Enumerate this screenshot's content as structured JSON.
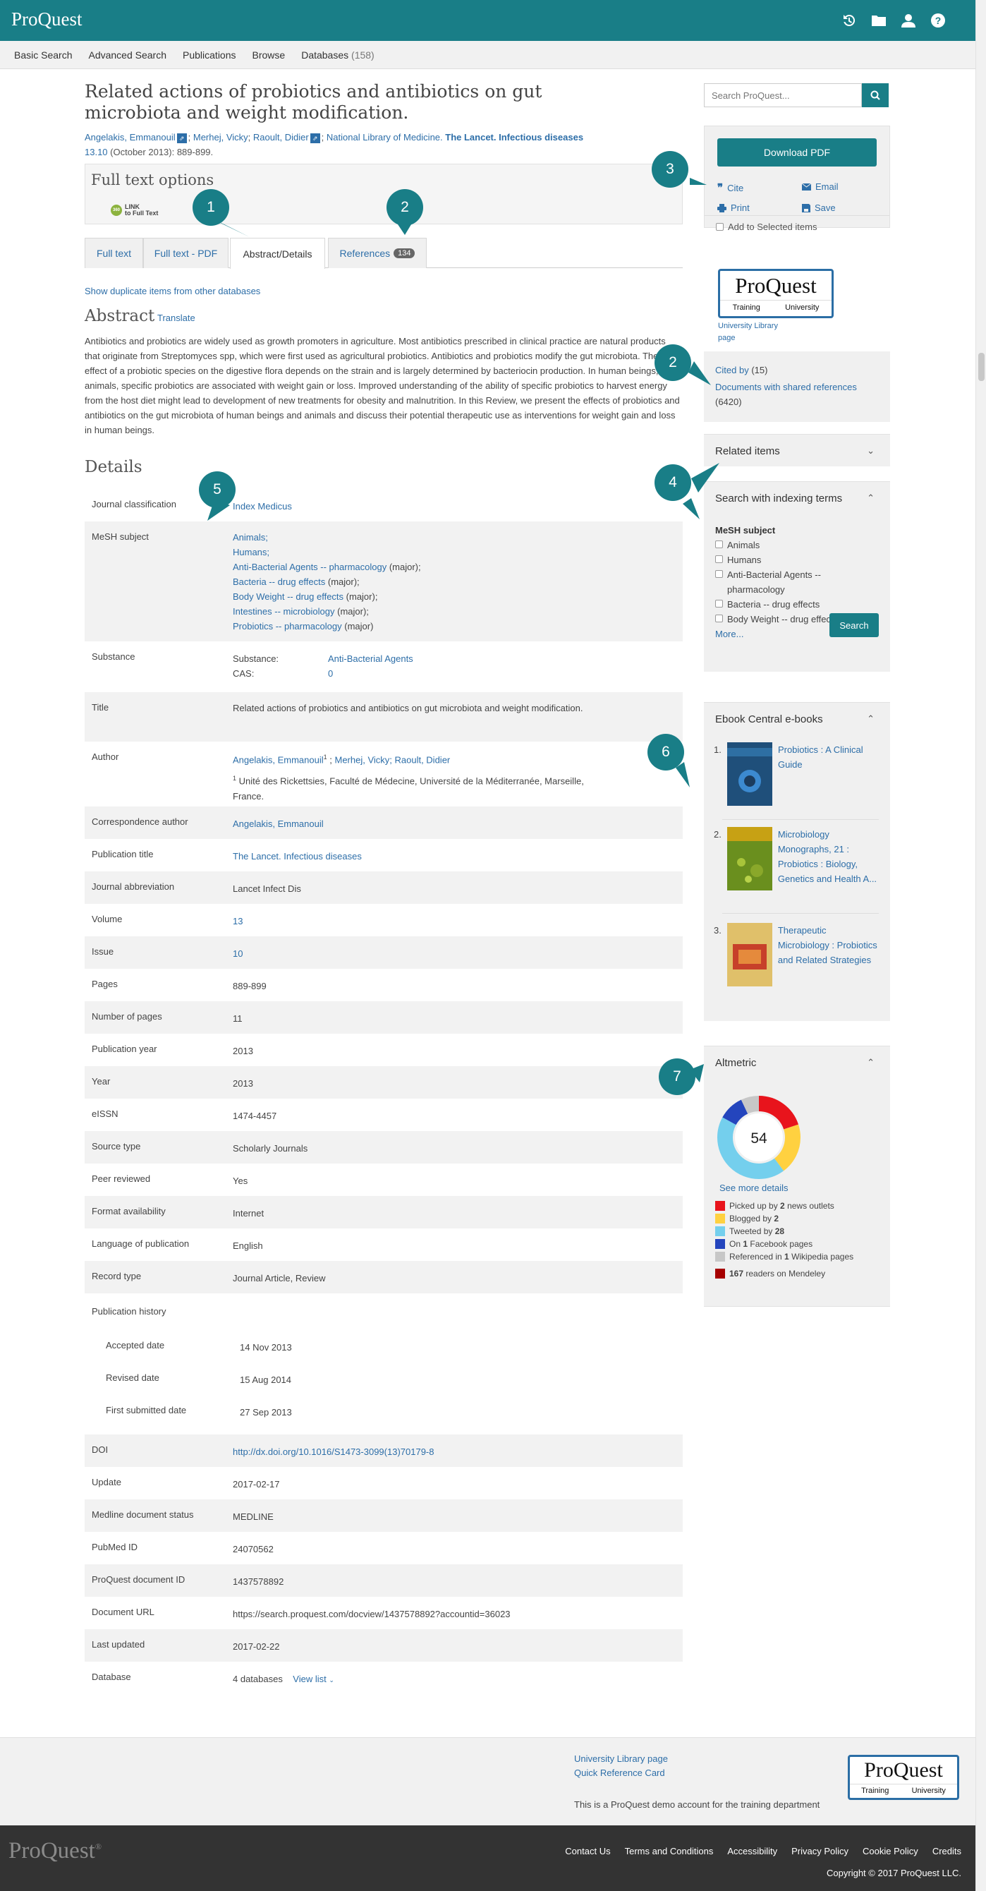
{
  "brand": {
    "logo_text": "ProQuest",
    "accent": "#197e87",
    "link_color": "#2d6ea8"
  },
  "topbar": {
    "icons": [
      "history-icon",
      "folder-icon",
      "user-icon",
      "help-icon"
    ]
  },
  "nav": {
    "items": [
      "Basic Search",
      "Advanced Search",
      "Publications",
      "Browse",
      "Databases"
    ],
    "databases_count": "(158)"
  },
  "document": {
    "title": "Related actions of probiotics and antibiotics on gut microbiota and weight modification.",
    "authors": [
      "Angelakis, Emmanouil",
      "Merhej, Vicky",
      "Raoult, Didier"
    ],
    "affiliation": "National Library of Medicine.",
    "journal": "The Lancet. Infectious diseases",
    "volume_issue": "13.10",
    "date_pages": "(October 2013): 889-899."
  },
  "full_text_options": {
    "heading": "Full text options",
    "link_label": "LINK",
    "link_sub": "to Full Text"
  },
  "tabs": [
    {
      "label": "Full text"
    },
    {
      "label": "Full text - PDF"
    },
    {
      "label": "Abstract/Details"
    },
    {
      "label": "References",
      "count": "134"
    }
  ],
  "duplicates_link": "Show duplicate items from other databases",
  "abstract": {
    "heading": "Abstract",
    "translate": "Translate",
    "text": "Antibiotics and probiotics are widely used as growth promoters in agriculture. Most antibiotics prescribed in clinical practice are natural products that originate from Streptomyces spp, which were first used as agricultural probiotics. Antibiotics and probiotics modify the gut microbiota. The effect of a probiotic species on the digestive flora depends on the strain and is largely determined by bacteriocin production. In human beings, as in animals, specific probiotics are associated with weight gain or loss. Improved understanding of the ability of specific probiotics to harvest energy from the host diet might lead to development of new treatments for obesity and malnutrition. In this Review, we present the effects of probiotics and antibiotics on the gut microbiota of human beings and animals and discuss their potential therapeutic use as interventions for weight gain and loss in human beings."
  },
  "details": {
    "heading": "Details",
    "journal_classification": {
      "label": "Journal classification",
      "value": "Index Medicus"
    },
    "mesh": {
      "label": "MeSH subject",
      "items": [
        "Animals;",
        "Humans;",
        "Anti-Bacterial Agents -- pharmacology",
        "Bacteria -- drug effects",
        "Body Weight -- drug effects",
        "Intestines -- microbiology",
        "Probiotics -- pharmacology"
      ],
      "suffixes": [
        "",
        "",
        " (major);",
        " (major);",
        " (major);",
        " (major);",
        " (major)"
      ]
    },
    "substance": {
      "label": "Substance",
      "k1": "Substance:",
      "v1": "Anti-Bacterial Agents",
      "k2": "CAS:",
      "v2": "0"
    },
    "title": {
      "label": "Title",
      "value": "Related actions of probiotics and antibiotics on gut microbiota and weight modification."
    },
    "author": {
      "label": "Author",
      "a1": "Angelakis, Emmanouil",
      "sup": "1",
      "rest": "Merhej, Vicky; Raoult, Didier",
      "aff_sup": "1",
      "affiliation": "Unité des Rickettsies, Faculté de Médecine, Université de la Méditerranée, Marseille, France."
    },
    "corr_author": {
      "label": "Correspondence author",
      "value": "Angelakis, Emmanouil"
    },
    "pub_title": {
      "label": "Publication title",
      "value": "The Lancet. Infectious diseases"
    },
    "abbrev": {
      "label": "Journal abbreviation",
      "value": "Lancet Infect Dis"
    },
    "volume": {
      "label": "Volume",
      "value": "13"
    },
    "issue": {
      "label": "Issue",
      "value": "10"
    },
    "pages": {
      "label": "Pages",
      "value": "889-899"
    },
    "num_pages": {
      "label": "Number of pages",
      "value": "11"
    },
    "pub_year": {
      "label": "Publication year",
      "value": "2013"
    },
    "year": {
      "label": "Year",
      "value": "2013"
    },
    "eissn": {
      "label": "eISSN",
      "value": "1474-4457"
    },
    "source_type": {
      "label": "Source type",
      "value": "Scholarly Journals"
    },
    "peer": {
      "label": "Peer reviewed",
      "value": "Yes"
    },
    "format": {
      "label": "Format availability",
      "value": "Internet"
    },
    "language": {
      "label": "Language of publication",
      "value": "English"
    },
    "record_type": {
      "label": "Record type",
      "value": "Journal Article, Review"
    },
    "pub_history": {
      "label": "Publication history"
    },
    "accepted": {
      "label": "Accepted date",
      "value": "14 Nov 2013"
    },
    "revised": {
      "label": "Revised date",
      "value": "15 Aug 2014"
    },
    "submitted": {
      "label": "First submitted date",
      "value": "27 Sep 2013"
    },
    "doi": {
      "label": "DOI",
      "value": "http://dx.doi.org/10.1016/S1473-3099(13)70179-8"
    },
    "update": {
      "label": "Update",
      "value": "2017-02-17"
    },
    "medline": {
      "label": "Medline document status",
      "value": "MEDLINE"
    },
    "pubmed": {
      "label": "PubMed ID",
      "value": "24070562"
    },
    "pq_id": {
      "label": "ProQuest document ID",
      "value": "1437578892"
    },
    "doc_url": {
      "label": "Document URL",
      "value": "https://search.proquest.com/docview/1437578892?accountid=36023"
    },
    "last_updated": {
      "label": "Last updated",
      "value": "2017-02-22"
    },
    "database": {
      "label": "Database",
      "value": "4 databases",
      "view": "View list"
    }
  },
  "sidebar": {
    "search_placeholder": "Search ProQuest...",
    "download_pdf": "Download PDF",
    "cite": "Cite",
    "email": "Email",
    "print": "Print",
    "save": "Save",
    "add_selected": "Add to Selected items",
    "logo_big": "ProQuest",
    "logo_left": "Training",
    "logo_right": "University",
    "univ_link": "University Library page",
    "cited_by": "Cited by",
    "cited_count": "(15)",
    "shared_refs": "Documents with shared references",
    "shared_count": "(6420)",
    "related_items": "Related items",
    "indexing_terms": "Search with indexing terms",
    "mesh_heading": "MeSH subject",
    "mesh_items": [
      "Animals",
      "Humans",
      "Anti-Bacterial Agents -- pharmacology",
      "Bacteria -- drug effects",
      "Body Weight -- drug effects"
    ],
    "more": "More...",
    "search_btn": "Search",
    "ebook_heading": "Ebook Central e-books",
    "ebooks": [
      {
        "n": "1.",
        "title": "Probiotics : A Clinical Guide"
      },
      {
        "n": "2.",
        "title": "Microbiology Monographs, 21 : Probiotics : Biology, Genetics and Health A..."
      },
      {
        "n": "3.",
        "title": "Therapeutic Microbiology : Probiotics and Related Strategies"
      }
    ],
    "altmetric_heading": "Altmetric",
    "altmetric_score": "54",
    "see_more": "See more details",
    "alt_rows": [
      {
        "pre": "Picked up by ",
        "num": "2",
        "post": " news outlets",
        "color": "#e8141c"
      },
      {
        "pre": "Blogged by ",
        "num": "2",
        "post": "",
        "color": "#ffd140"
      },
      {
        "pre": "Tweeted by ",
        "num": "28",
        "post": "",
        "color": "#74cfed"
      },
      {
        "pre": "On ",
        "num": "1",
        "post": " Facebook pages",
        "color": "#2445bd"
      },
      {
        "pre": "Referenced in ",
        "num": "1",
        "post": " Wikipedia pages",
        "color": "#c7c7c7"
      },
      {
        "pre": "",
        "num": "167",
        "post": " readers on Mendeley",
        "color": "#a60000"
      }
    ]
  },
  "callouts": [
    "1",
    "2",
    "3",
    "2",
    "4",
    "5",
    "6",
    "7"
  ],
  "footer": {
    "univ_link": "University Library page",
    "qrc": "Quick Reference Card",
    "demo": "This is a ProQuest demo account for the training department",
    "logo": "ProQuest",
    "links": [
      "Contact Us",
      "Terms and Conditions",
      "Accessibility",
      "Privacy Policy",
      "Cookie Policy",
      "Credits"
    ],
    "copyright": "Copyright © 2017 ProQuest LLC."
  }
}
